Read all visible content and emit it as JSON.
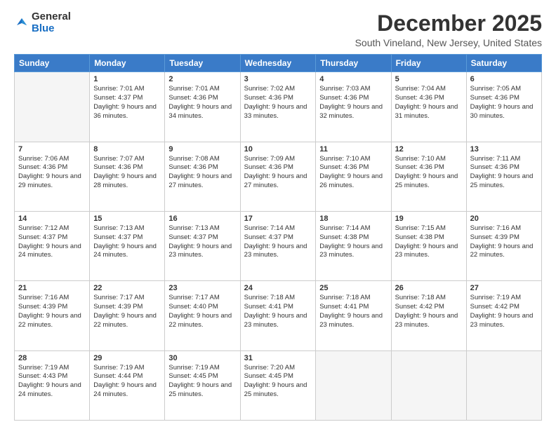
{
  "logo": {
    "general": "General",
    "blue": "Blue"
  },
  "header": {
    "month_year": "December 2025",
    "location": "South Vineland, New Jersey, United States"
  },
  "weekdays": [
    "Sunday",
    "Monday",
    "Tuesday",
    "Wednesday",
    "Thursday",
    "Friday",
    "Saturday"
  ],
  "weeks": [
    [
      {
        "day": "",
        "empty": true
      },
      {
        "day": "1",
        "sunrise": "7:01 AM",
        "sunset": "4:37 PM",
        "daylight": "9 hours and 36 minutes."
      },
      {
        "day": "2",
        "sunrise": "7:01 AM",
        "sunset": "4:36 PM",
        "daylight": "9 hours and 34 minutes."
      },
      {
        "day": "3",
        "sunrise": "7:02 AM",
        "sunset": "4:36 PM",
        "daylight": "9 hours and 33 minutes."
      },
      {
        "day": "4",
        "sunrise": "7:03 AM",
        "sunset": "4:36 PM",
        "daylight": "9 hours and 32 minutes."
      },
      {
        "day": "5",
        "sunrise": "7:04 AM",
        "sunset": "4:36 PM",
        "daylight": "9 hours and 31 minutes."
      },
      {
        "day": "6",
        "sunrise": "7:05 AM",
        "sunset": "4:36 PM",
        "daylight": "9 hours and 30 minutes."
      }
    ],
    [
      {
        "day": "7",
        "sunrise": "7:06 AM",
        "sunset": "4:36 PM",
        "daylight": "9 hours and 29 minutes."
      },
      {
        "day": "8",
        "sunrise": "7:07 AM",
        "sunset": "4:36 PM",
        "daylight": "9 hours and 28 minutes."
      },
      {
        "day": "9",
        "sunrise": "7:08 AM",
        "sunset": "4:36 PM",
        "daylight": "9 hours and 27 minutes."
      },
      {
        "day": "10",
        "sunrise": "7:09 AM",
        "sunset": "4:36 PM",
        "daylight": "9 hours and 27 minutes."
      },
      {
        "day": "11",
        "sunrise": "7:10 AM",
        "sunset": "4:36 PM",
        "daylight": "9 hours and 26 minutes."
      },
      {
        "day": "12",
        "sunrise": "7:10 AM",
        "sunset": "4:36 PM",
        "daylight": "9 hours and 25 minutes."
      },
      {
        "day": "13",
        "sunrise": "7:11 AM",
        "sunset": "4:36 PM",
        "daylight": "9 hours and 25 minutes."
      }
    ],
    [
      {
        "day": "14",
        "sunrise": "7:12 AM",
        "sunset": "4:37 PM",
        "daylight": "9 hours and 24 minutes."
      },
      {
        "day": "15",
        "sunrise": "7:13 AM",
        "sunset": "4:37 PM",
        "daylight": "9 hours and 24 minutes."
      },
      {
        "day": "16",
        "sunrise": "7:13 AM",
        "sunset": "4:37 PM",
        "daylight": "9 hours and 23 minutes."
      },
      {
        "day": "17",
        "sunrise": "7:14 AM",
        "sunset": "4:37 PM",
        "daylight": "9 hours and 23 minutes."
      },
      {
        "day": "18",
        "sunrise": "7:14 AM",
        "sunset": "4:38 PM",
        "daylight": "9 hours and 23 minutes."
      },
      {
        "day": "19",
        "sunrise": "7:15 AM",
        "sunset": "4:38 PM",
        "daylight": "9 hours and 23 minutes."
      },
      {
        "day": "20",
        "sunrise": "7:16 AM",
        "sunset": "4:39 PM",
        "daylight": "9 hours and 22 minutes."
      }
    ],
    [
      {
        "day": "21",
        "sunrise": "7:16 AM",
        "sunset": "4:39 PM",
        "daylight": "9 hours and 22 minutes."
      },
      {
        "day": "22",
        "sunrise": "7:17 AM",
        "sunset": "4:39 PM",
        "daylight": "9 hours and 22 minutes."
      },
      {
        "day": "23",
        "sunrise": "7:17 AM",
        "sunset": "4:40 PM",
        "daylight": "9 hours and 22 minutes."
      },
      {
        "day": "24",
        "sunrise": "7:18 AM",
        "sunset": "4:41 PM",
        "daylight": "9 hours and 23 minutes."
      },
      {
        "day": "25",
        "sunrise": "7:18 AM",
        "sunset": "4:41 PM",
        "daylight": "9 hours and 23 minutes."
      },
      {
        "day": "26",
        "sunrise": "7:18 AM",
        "sunset": "4:42 PM",
        "daylight": "9 hours and 23 minutes."
      },
      {
        "day": "27",
        "sunrise": "7:19 AM",
        "sunset": "4:42 PM",
        "daylight": "9 hours and 23 minutes."
      }
    ],
    [
      {
        "day": "28",
        "sunrise": "7:19 AM",
        "sunset": "4:43 PM",
        "daylight": "9 hours and 24 minutes."
      },
      {
        "day": "29",
        "sunrise": "7:19 AM",
        "sunset": "4:44 PM",
        "daylight": "9 hours and 24 minutes."
      },
      {
        "day": "30",
        "sunrise": "7:19 AM",
        "sunset": "4:45 PM",
        "daylight": "9 hours and 25 minutes."
      },
      {
        "day": "31",
        "sunrise": "7:20 AM",
        "sunset": "4:45 PM",
        "daylight": "9 hours and 25 minutes."
      },
      {
        "day": "",
        "empty": true
      },
      {
        "day": "",
        "empty": true
      },
      {
        "day": "",
        "empty": true
      }
    ]
  ],
  "labels": {
    "sunrise": "Sunrise:",
    "sunset": "Sunset:",
    "daylight": "Daylight:"
  }
}
